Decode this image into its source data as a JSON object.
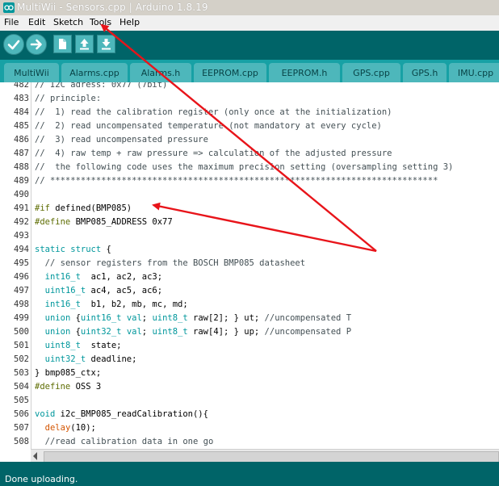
{
  "window": {
    "title": "MultiWii - Sensors.cpp | Arduino 1.8.19"
  },
  "menu": [
    "File",
    "Edit",
    "Sketch",
    "Tools",
    "Help"
  ],
  "tabs": [
    "MultiWii",
    "Alarms.cpp",
    "Alarms.h",
    "EEPROM.cpp",
    "EEPROM.h",
    "GPS.cpp",
    "GPS.h",
    "IMU.cpp"
  ],
  "editor": {
    "lines": [
      {
        "n": "482",
        "t": "// I2C adress: 0x77 (7bit)"
      },
      {
        "n": "483",
        "t": "// principle:"
      },
      {
        "n": "484",
        "t": "//  1) read the calibration register (only once at the initialization)"
      },
      {
        "n": "485",
        "t": "//  2) read uncompensated temperature (not mandatory at every cycle)"
      },
      {
        "n": "486",
        "t": "//  3) read uncompensated pressure"
      },
      {
        "n": "487",
        "t": "//  4) raw temp + raw pressure => calculation of the adjusted pressure"
      },
      {
        "n": "488",
        "t": "//  the following code uses the maximum precision setting (oversampling setting 3)"
      },
      {
        "n": "489",
        "t": "// ****************************************************************************"
      },
      {
        "n": "490",
        "t": ""
      },
      {
        "n": "491",
        "t": "#if defined(BMP085)"
      },
      {
        "n": "492",
        "t": "#define BMP085_ADDRESS 0x77"
      },
      {
        "n": "493",
        "t": ""
      },
      {
        "n": "494",
        "t": "static struct {"
      },
      {
        "n": "495",
        "t": "  // sensor registers from the BOSCH BMP085 datasheet"
      },
      {
        "n": "496",
        "t": "  int16_t  ac1, ac2, ac3;"
      },
      {
        "n": "497",
        "t": "  uint16_t ac4, ac5, ac6;"
      },
      {
        "n": "498",
        "t": "  int16_t  b1, b2, mb, mc, md;"
      },
      {
        "n": "499",
        "t": "  union {uint16_t val; uint8_t raw[2]; } ut; //uncompensated T"
      },
      {
        "n": "500",
        "t": "  union {uint32_t val; uint8_t raw[4]; } up; //uncompensated P"
      },
      {
        "n": "501",
        "t": "  uint8_t  state;"
      },
      {
        "n": "502",
        "t": "  uint32_t deadline;"
      },
      {
        "n": "503",
        "t": "} bmp085_ctx;"
      },
      {
        "n": "504",
        "t": "#define OSS 3"
      },
      {
        "n": "505",
        "t": ""
      },
      {
        "n": "506",
        "t": "void i2c_BMP085_readCalibration(){"
      },
      {
        "n": "507",
        "t": "  delay(10);"
      },
      {
        "n": "508",
        "t": "  //read calibration data in one go"
      }
    ]
  },
  "status": {
    "message": "Done uploading."
  },
  "colors": {
    "teal_dark": "#006468",
    "teal_tab": "#4db7bb",
    "arrow": "#e8141a"
  },
  "icons": [
    "verify-icon",
    "upload-icon",
    "new-icon",
    "open-icon",
    "save-icon",
    "arduino-logo-icon"
  ]
}
